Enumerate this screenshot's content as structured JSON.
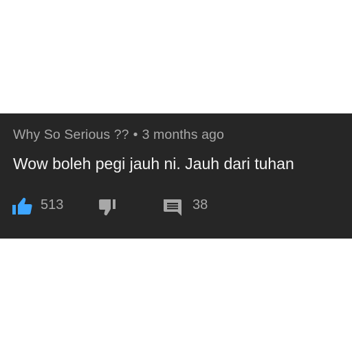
{
  "comment": {
    "author": "Why So Serious ??",
    "separator": "•",
    "timestamp": "3 months ago",
    "text": "Wow boleh pegi jauh ni. Jauh dari tuhan"
  },
  "actions": {
    "like_count": "513",
    "reply_count": "38",
    "like_icon": "thumbs-up-filled",
    "dislike_icon": "thumbs-down",
    "reply_icon": "comment"
  },
  "colors": {
    "card_background": "#262626",
    "like_active": "#3ea6ff",
    "muted_text": "#a8a8a8",
    "comment_text": "#f2f2f2"
  }
}
